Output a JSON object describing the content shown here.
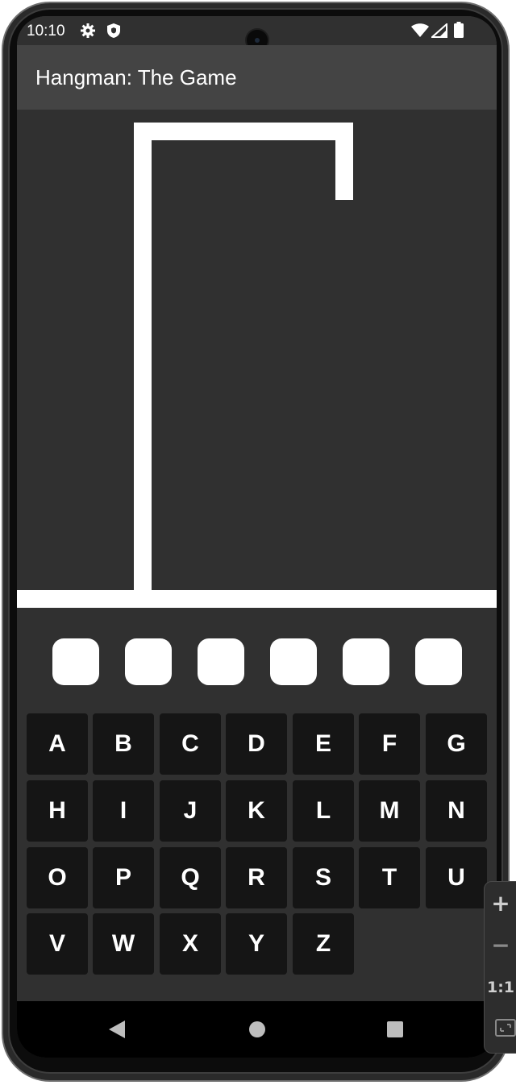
{
  "status_bar": {
    "time": "10:10",
    "left_icons": [
      "gear-icon",
      "shield-icon"
    ],
    "right_icons": [
      "wifi-icon",
      "signal-icon",
      "battery-icon"
    ]
  },
  "app_bar": {
    "title": "Hangman: The Game"
  },
  "game": {
    "word_length": 6,
    "revealed": [
      "",
      "",
      "",
      "",
      "",
      ""
    ]
  },
  "keyboard": {
    "rows": [
      [
        "A",
        "B",
        "C",
        "D",
        "E",
        "F",
        "G"
      ],
      [
        "H",
        "I",
        "J",
        "K",
        "L",
        "M",
        "N"
      ],
      [
        "O",
        "P",
        "Q",
        "R",
        "S",
        "T",
        "U"
      ],
      [
        "V",
        "W",
        "X",
        "Y",
        "Z"
      ]
    ]
  },
  "nav_bar": {
    "buttons": [
      "back-icon",
      "home-icon",
      "recents-icon"
    ]
  },
  "emulator_panel": {
    "items": [
      "+",
      "−",
      "1:1",
      "fit-icon"
    ]
  },
  "colors": {
    "background": "#303030",
    "app_bar": "#444444",
    "key": "#151515",
    "foreground": "#ffffff"
  }
}
